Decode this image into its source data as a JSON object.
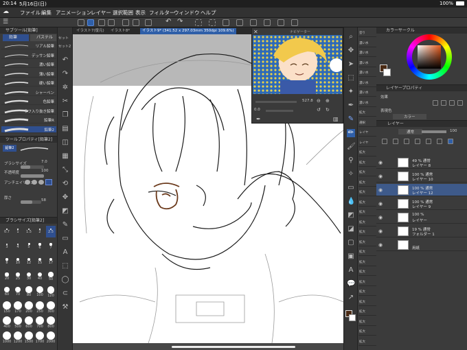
{
  "status_bar": {
    "time": "20:14",
    "date": "5月16日(日)",
    "battery": "100%"
  },
  "menu": [
    "ファイル",
    "編集",
    "アニメーション",
    "レイヤー",
    "選択範囲",
    "表示",
    "フィルター",
    "ウィンドウ",
    "ヘルプ"
  ],
  "sub_tool": {
    "title": "サブツール[鉛筆]",
    "tabs": [
      "鉛筆",
      "パステル"
    ],
    "brushes": [
      "リアル鉛筆",
      "デッサン鉛筆",
      "濃い鉛筆",
      "薄い鉛筆",
      "硬い鉛筆",
      "シャーペン",
      "色鉛筆",
      "ラフ入り抜き鉛筆",
      "鉛筆R",
      "鉛筆2"
    ],
    "selected_brush": "鉛筆2"
  },
  "tool_property": {
    "title": "ツールプロパティ[鉛筆2]",
    "name": "鉛筆2",
    "brush_size_label": "ブラシサイズ",
    "brush_size": "7.0",
    "opacity_label": "不透明度",
    "opacity": "100",
    "antialias_label": "アンチエイリアス",
    "thickness_label": "厚さ",
    "thickness": "58"
  },
  "brush_size_panel": {
    "title": "ブラシサイズ[鉛筆2]",
    "sizes": [
      "0.7",
      "1",
      "1.5",
      "2",
      "2.5",
      "3",
      "4",
      "5",
      "6",
      "7",
      "8",
      "10",
      "12",
      "15",
      "17",
      "20",
      "25",
      "30",
      "40",
      "50",
      "60",
      "70",
      "80",
      "100",
      "120",
      "150",
      "170",
      "200",
      "250",
      "300",
      "400",
      "500",
      "600",
      "700",
      "800",
      "1000",
      "1200",
      "1500",
      "1700",
      "2000"
    ],
    "selected": "2.5"
  },
  "canvas": {
    "tabs": [
      "イラスト7(復元)",
      "イラスト8*",
      "イラスト9* (341.52 x 297.03mm 350dpi 109.6%)"
    ],
    "active_tab": 2
  },
  "navigator": {
    "title": "ナビゲーター",
    "zoom": "527.8",
    "rotation": "0.0"
  },
  "side_strip": [
    "セット",
    "セット2"
  ],
  "right_brushes": [
    "塗り",
    "濃い水",
    "濃い水",
    "濃い水",
    "濃い水",
    "濃い水",
    "濃い水",
    "濃い水",
    "拡大",
    "選択",
    "レイヤ",
    "レイヤ",
    "拡大",
    "拡大",
    "拡大",
    "拡大",
    "拡大",
    "拡大",
    "拡大",
    "拡大",
    "拡大",
    "拡大",
    "拡大",
    "拡大",
    "拡大",
    "拡大",
    "拡大",
    "拡大",
    "拡大",
    "拡大",
    "拡大",
    "拡大"
  ],
  "color_panel": {
    "title": "カラーサークル",
    "main_color": "#4a2a14",
    "sub_color": "#ffffff"
  },
  "layer_property": {
    "title": "レイヤープロパティ",
    "effect_label": "効果",
    "expression_label": "表現色",
    "expression_value": "カラー"
  },
  "layer_panel": {
    "title": "レイヤー",
    "blend": "通常",
    "opacity": "100",
    "layers": [
      {
        "line1": "49 % 通常",
        "line2": "レイヤー 8",
        "selected": false
      },
      {
        "line1": "100 % 通常",
        "line2": "レイヤー 10",
        "selected": false
      },
      {
        "line1": "100 % 通常",
        "line2": "レイヤー 12",
        "selected": true
      },
      {
        "line1": "100 % 通常",
        "line2": "レイヤー 9",
        "selected": false
      },
      {
        "line1": "100 %",
        "line2": "レイヤー",
        "selected": false
      },
      {
        "line1": "19 % 通常",
        "line2": "フォルダー 1",
        "selected": false
      },
      {
        "line1": "",
        "line2": "用紙",
        "selected": false
      }
    ]
  }
}
